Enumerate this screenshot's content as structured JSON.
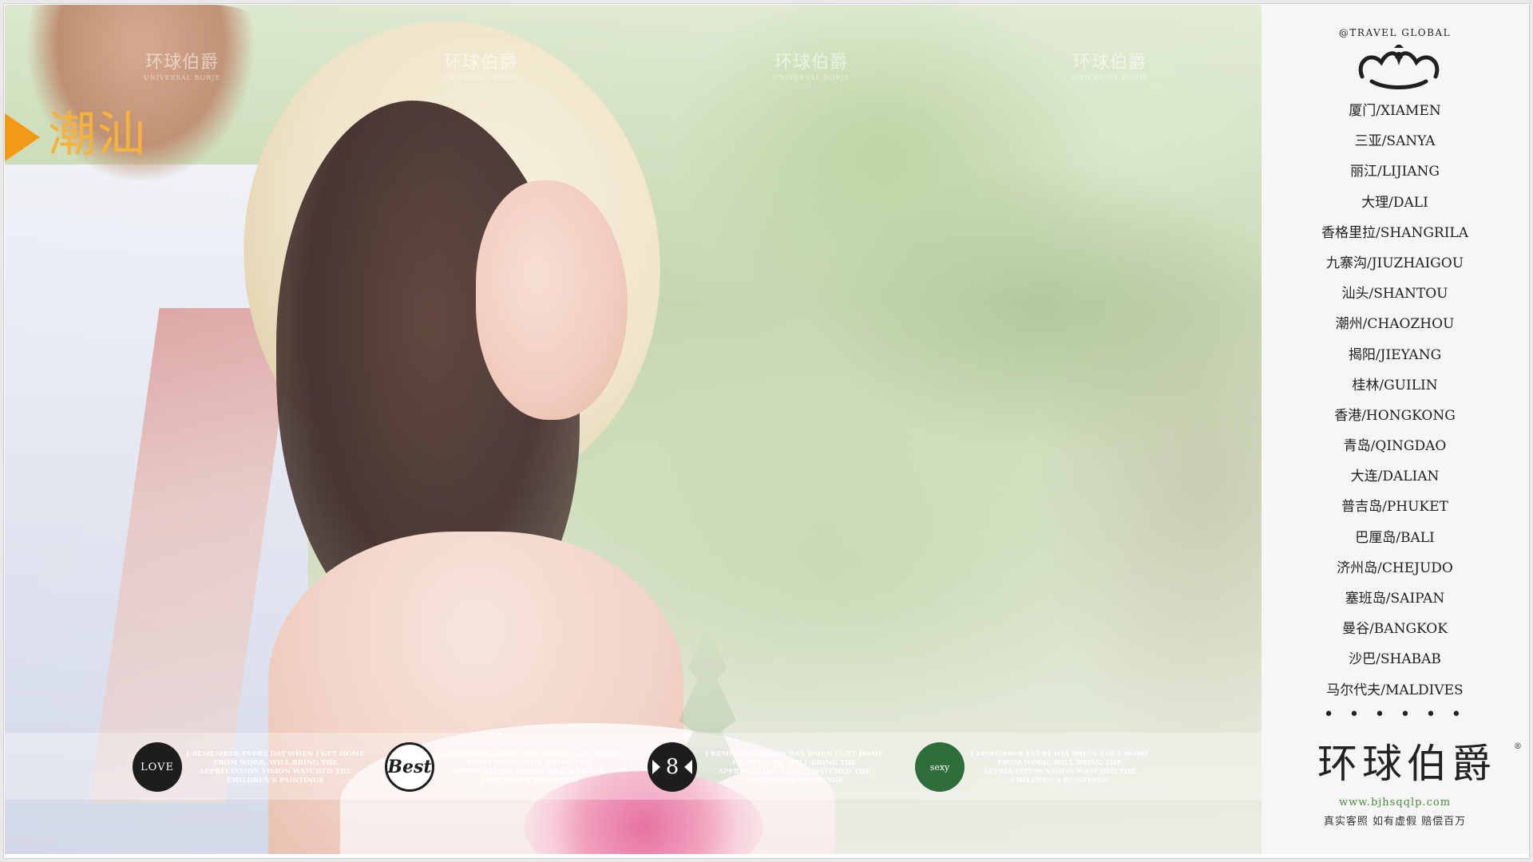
{
  "photo": {
    "city_title": "潮汕",
    "watermarks": [
      {
        "text": "环球伯爵",
        "sub": "UNIVERSAL BORJE"
      },
      {
        "text": "环球伯爵",
        "sub": "UNIVERSAL BORJE"
      },
      {
        "text": "环球伯爵",
        "sub": "UNIVERSAL BORJE"
      },
      {
        "text": "环球伯爵",
        "sub": "UNIVERSAL BORJE"
      }
    ],
    "badges": {
      "love": "LOVE",
      "best": "Best",
      "eight": "8",
      "sexy": "sexy"
    },
    "blurb": "I REMEMBER EVERY DAY WHEN I GET HOME FROM WORK, WILL BRING THE APPRECIATION VISION WATCHED THE CHILDREN'S PAINTINGS"
  },
  "sidebar": {
    "brand_top": "@TRAVEL GLOBAL",
    "cities": [
      {
        "zh": "厦门",
        "en": "/XIAMEN"
      },
      {
        "zh": "三亚",
        "en": "/SANYA"
      },
      {
        "zh": "丽江",
        "en": "/LIJIANG"
      },
      {
        "zh": "大理",
        "en": "/DALI"
      },
      {
        "zh": "香格里拉",
        "en": "/SHANGRILA"
      },
      {
        "zh": "九寨沟",
        "en": "/JIUZHAIGOU"
      },
      {
        "zh": "汕头",
        "en": "/SHANTOU"
      },
      {
        "zh": "潮州",
        "en": "/CHAOZHOU"
      },
      {
        "zh": "揭阳",
        "en": "/JIEYANG"
      },
      {
        "zh": "桂林",
        "en": "/GUILIN"
      },
      {
        "zh": "香港",
        "en": "/HONGKONG"
      },
      {
        "zh": "青岛",
        "en": "/QINGDAO"
      },
      {
        "zh": "大连",
        "en": "/DALIAN"
      },
      {
        "zh": "普吉岛",
        "en": "/PHUKET"
      },
      {
        "zh": "巴厘岛",
        "en": "/BALI"
      },
      {
        "zh": "济州岛",
        "en": "/CHEJUDO"
      },
      {
        "zh": "塞班岛",
        "en": "/SAIPAN"
      },
      {
        "zh": "曼谷",
        "en": "/BANGKOK"
      },
      {
        "zh": "沙巴",
        "en": "/SHABAB"
      },
      {
        "zh": "马尔代夫",
        "en": "/MALDIVES"
      }
    ],
    "more_dots": "• • •   • • •",
    "brand_name": "环球伯爵",
    "brand_reg": "®",
    "brand_url": "www.bjhsqqlp.com",
    "slogan": "真实客照 如有虚假 赔偿百万"
  },
  "colors": {
    "title_orange": "#f5b33c",
    "arrow_orange": "#f29a16",
    "url_green": "#4a8a3c",
    "sexy_badge_green": "#2d6e3b"
  }
}
